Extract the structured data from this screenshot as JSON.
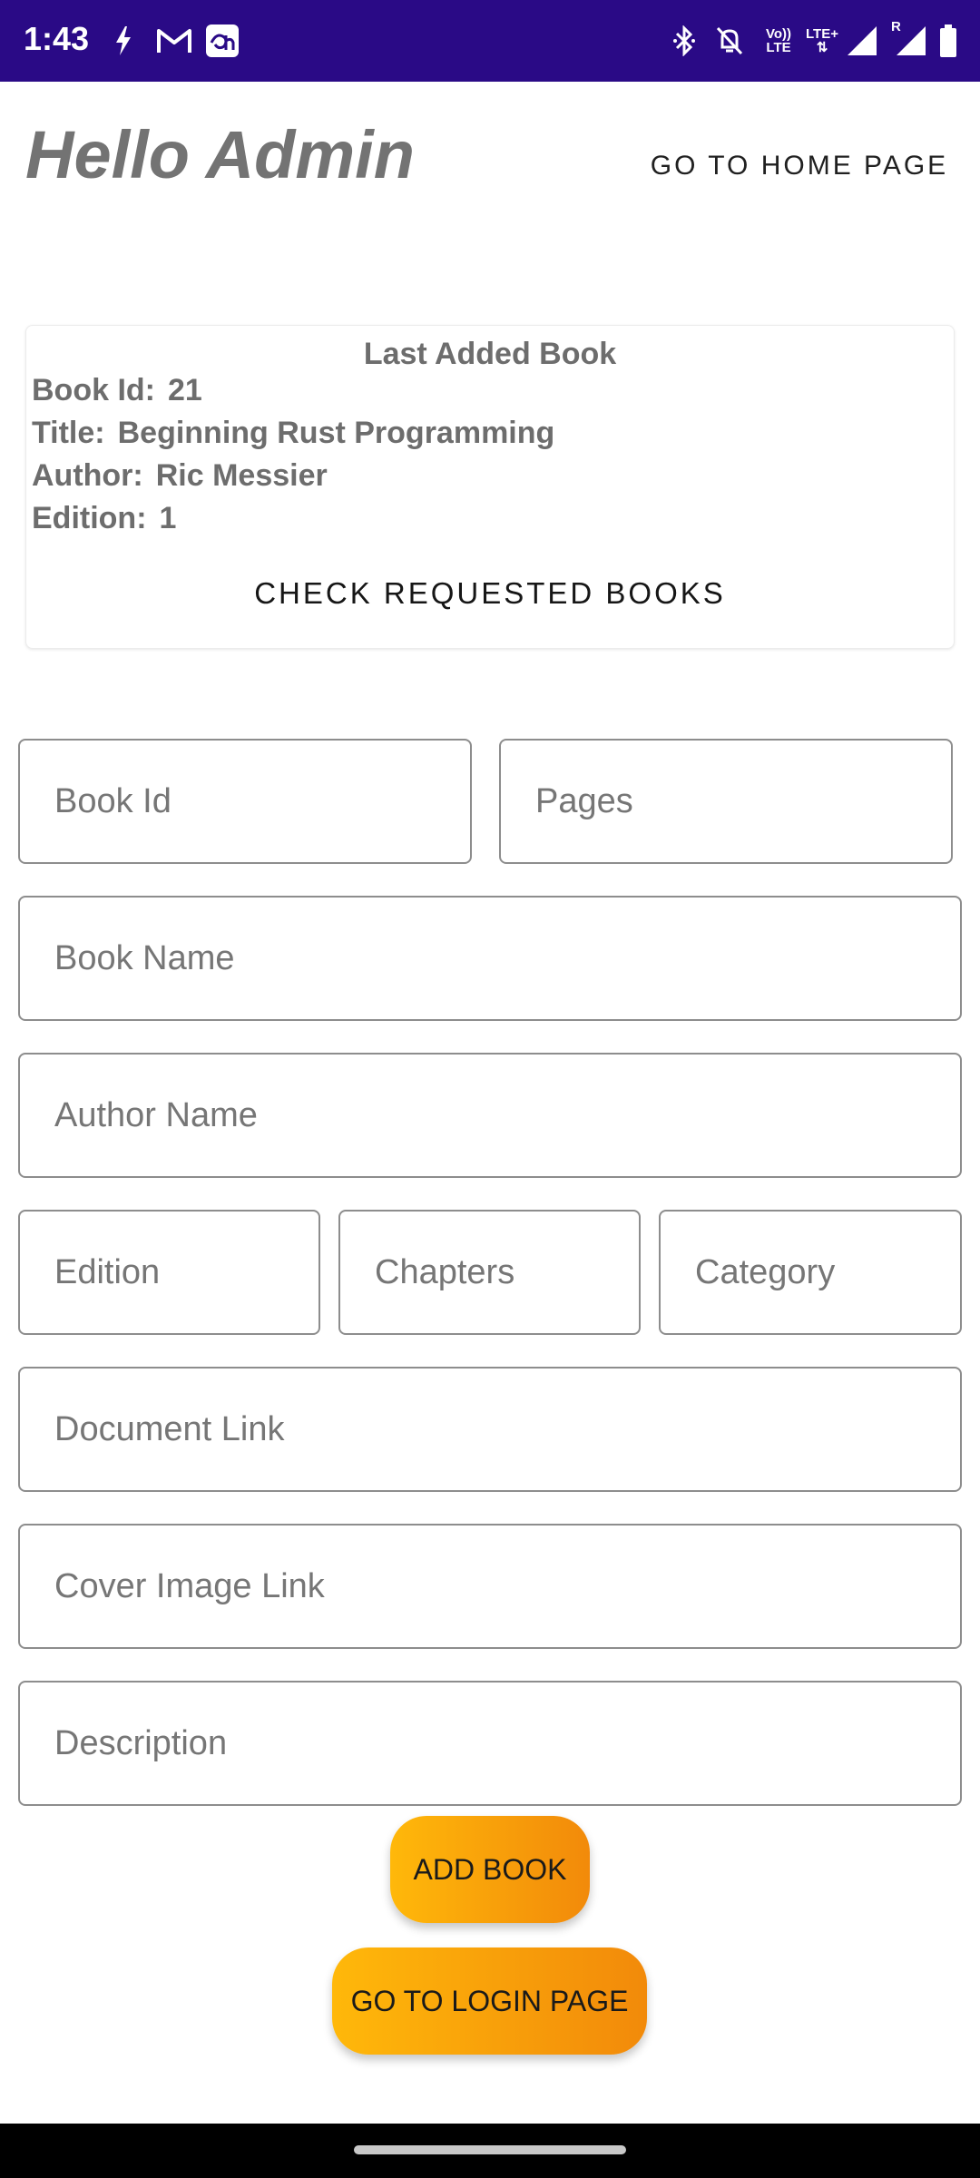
{
  "status_bar": {
    "time": "1:43",
    "left_icons": [
      "flash-icon",
      "gmail-icon",
      "hotstar-icon"
    ],
    "right_icons": [
      "bluetooth-icon",
      "bell-off-icon",
      "volte-icon",
      "lte-plus-icon",
      "signal-icon",
      "roaming-signal-icon",
      "battery-icon"
    ],
    "volte_label_top": "Vo))",
    "volte_label_bottom": "LTE",
    "lte_plus_label": "LTE+",
    "roaming_label": "R",
    "background": "#2a0a86"
  },
  "header": {
    "greeting": "Hello Admin",
    "home_link": "GO TO HOME PAGE"
  },
  "last_added": {
    "title": "Last Added Book",
    "rows": [
      {
        "label": "Book Id:",
        "value": "21"
      },
      {
        "label": "Title:",
        "value": "Beginning Rust Programming"
      },
      {
        "label": "Author:",
        "value": "Ric Messier"
      },
      {
        "label": "Edition:",
        "value": "1"
      }
    ],
    "check_button": "CHECK REQUESTED BOOKS"
  },
  "form": {
    "book_id": {
      "placeholder": "Book Id",
      "value": ""
    },
    "pages": {
      "placeholder": "Pages",
      "value": ""
    },
    "book_name": {
      "placeholder": "Book Name",
      "value": ""
    },
    "author_name": {
      "placeholder": "Author Name",
      "value": ""
    },
    "edition": {
      "placeholder": "Edition",
      "value": ""
    },
    "chapters": {
      "placeholder": "Chapters",
      "value": ""
    },
    "category": {
      "placeholder": "Category",
      "value": ""
    },
    "document_link": {
      "placeholder": "Document Link",
      "value": ""
    },
    "cover_image_link": {
      "placeholder": "Cover Image Link",
      "value": ""
    },
    "description": {
      "placeholder": "Description",
      "value": ""
    }
  },
  "buttons": {
    "add_book": "ADD BOOK",
    "login_page": "GO TO LOGIN PAGE",
    "gradient_start": "#ffb80a",
    "gradient_end": "#f28a0a"
  }
}
